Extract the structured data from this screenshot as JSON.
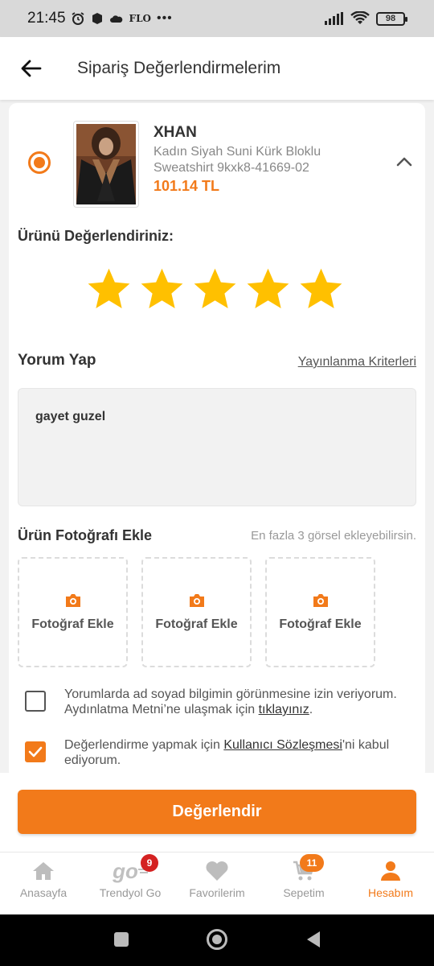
{
  "status_bar": {
    "time": "21:45",
    "carrier_text": "FLO",
    "battery": "98"
  },
  "header": {
    "title": "Sipariş Değerlendirmelerim"
  },
  "product": {
    "brand": "XHAN",
    "name": "Kadın Siyah Suni Kürk Bloklu Sweatshirt  9kxk8-41669-02",
    "price": "101.14 TL"
  },
  "rating": {
    "label": "Ürünü Değerlendiriniz:",
    "stars": 5,
    "max": 5
  },
  "comment": {
    "label": "Yorum Yap",
    "criteria_link": "Yayınlanma Kriterleri",
    "text": "gayet guzel"
  },
  "photos": {
    "label": "Ürün Fotoğrafı Ekle",
    "hint": "En fazla 3 görsel ekleyebilirsin.",
    "slots": [
      "Fotoğraf Ekle",
      "Fotoğraf Ekle",
      "Fotoğraf Ekle"
    ]
  },
  "consents": {
    "name_visibility": {
      "text_before": "Yorumlarda ad soyad bilgimin görünmesine izin veriyorum. Aydınlatma Metni’ne ulaşmak için ",
      "link": "tıklayınız",
      "text_after": ".",
      "checked": false
    },
    "agreement": {
      "text_before": "Değerlendirme yapmak için ",
      "link": "Kullanıcı Sözleşmesi",
      "text_after": "'ni kabul ediyorum.",
      "checked": true
    }
  },
  "submit_label": "Değerlendir",
  "bottom_nav": [
    {
      "label": "Anasayfa",
      "icon": "home-icon"
    },
    {
      "label": "Trendyol Go",
      "icon": "go-icon",
      "logo": "go",
      "badge": "9"
    },
    {
      "label": "Favorilerim",
      "icon": "heart-icon"
    },
    {
      "label": "Sepetim",
      "icon": "cart-icon",
      "badge": "11"
    },
    {
      "label": "Hesabım",
      "icon": "user-icon",
      "active": true
    }
  ],
  "colors": {
    "accent": "#f27a1a",
    "badge_red": "#d42121",
    "star": "#ffc000"
  }
}
